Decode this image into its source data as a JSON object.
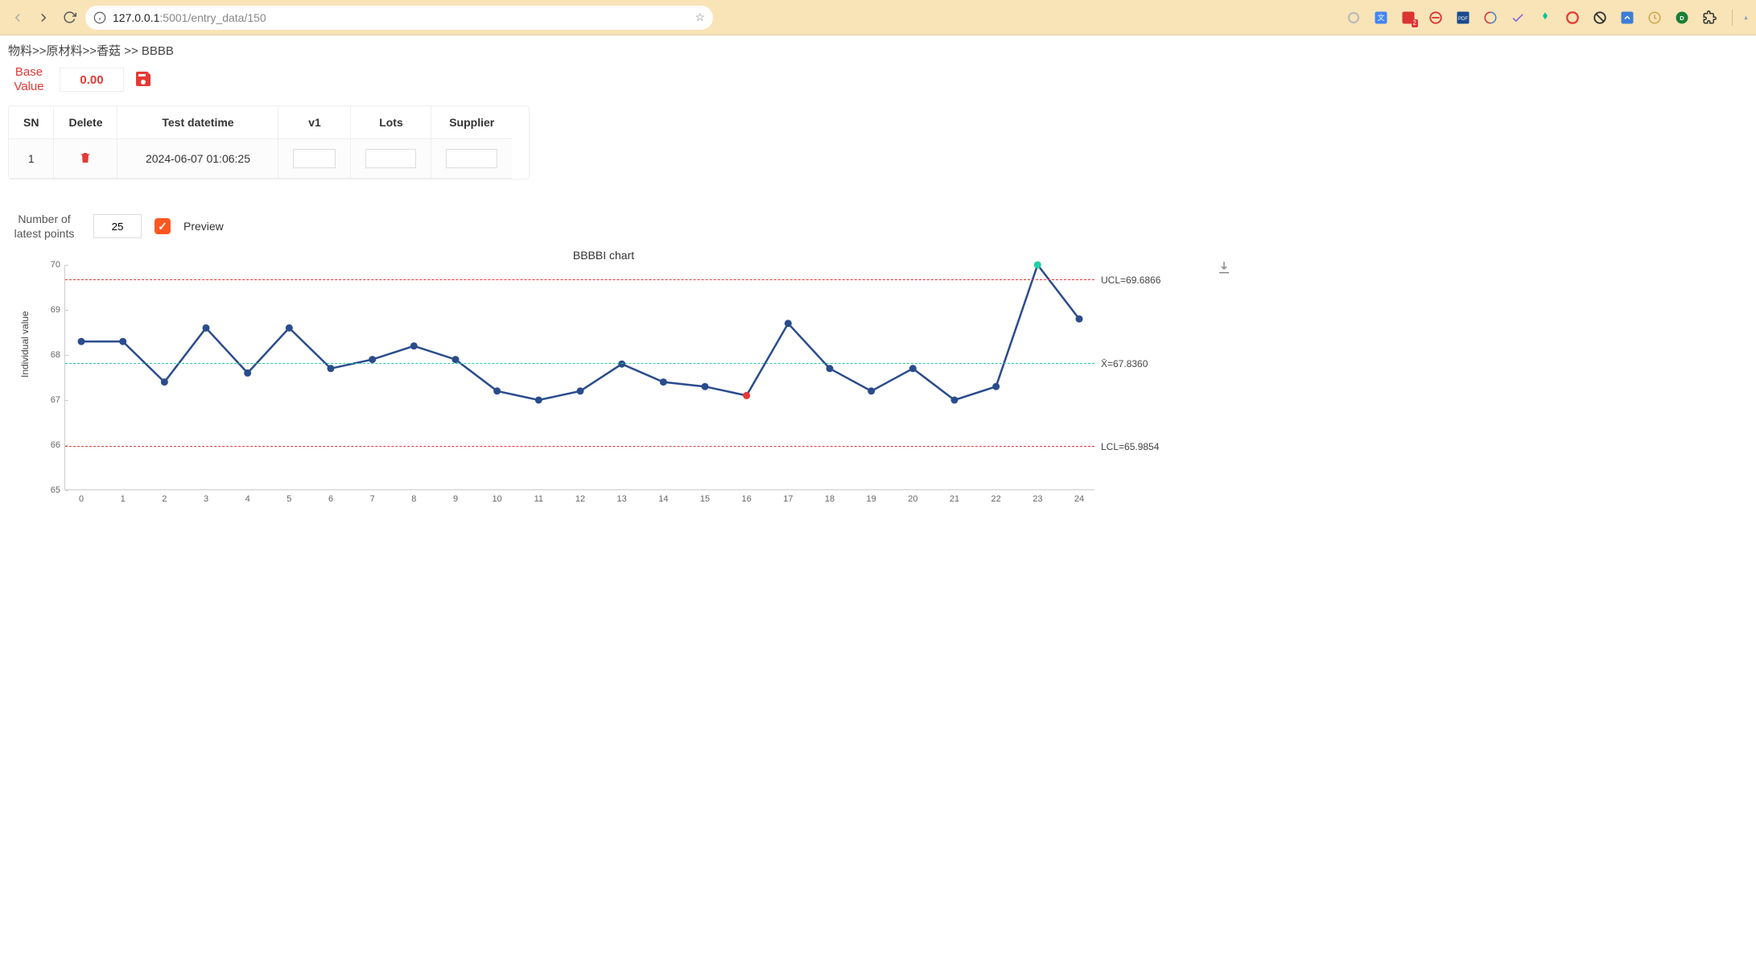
{
  "browser": {
    "url_host": "127.0.0.1",
    "url_port_path": ":5001/entry_data/150"
  },
  "breadcrumb": "物料>>原材料>>香菇 >> BBBB",
  "base": {
    "label_top": "Base",
    "label_bottom": "Value",
    "value": "0.00"
  },
  "table": {
    "headers": {
      "sn": "SN",
      "delete": "Delete",
      "dt": "Test datetime",
      "v1": "v1",
      "lots": "Lots",
      "supplier": "Supplier"
    },
    "rows": [
      {
        "sn": "1",
        "dt": "2024-06-07 01:06:25",
        "v1": "",
        "lots": "",
        "supplier": ""
      }
    ]
  },
  "preview": {
    "label_top": "Number of",
    "label_bottom": "latest points",
    "value": "25",
    "checkbox_checked": true,
    "preview_label": "Preview"
  },
  "chart_data": {
    "type": "line",
    "title": "BBBBI chart",
    "ylabel": "Individual value",
    "xlabel": "",
    "ylim": [
      65,
      70
    ],
    "x": [
      0,
      1,
      2,
      3,
      4,
      5,
      6,
      7,
      8,
      9,
      10,
      11,
      12,
      13,
      14,
      15,
      16,
      17,
      18,
      19,
      20,
      21,
      22,
      23,
      24
    ],
    "values": [
      68.3,
      68.3,
      67.4,
      68.6,
      67.6,
      68.6,
      67.7,
      67.9,
      68.2,
      67.9,
      67.2,
      67.0,
      67.2,
      67.8,
      67.4,
      67.3,
      67.1,
      68.7,
      67.7,
      67.2,
      67.7,
      67.0,
      67.3,
      70.0,
      68.8
    ],
    "point_colors": {
      "normal": "#2a4c8c",
      "red_idx": 16,
      "green_idx": 23
    },
    "hlines": {
      "ucl": {
        "value": 69.6866,
        "label": "UCL=69.6866",
        "color": "red"
      },
      "mean": {
        "value": 67.836,
        "label": "X̄=67.8360",
        "color": "green"
      },
      "lcl": {
        "value": 65.9854,
        "label": "LCL=65.9854",
        "color": "red"
      }
    },
    "y_ticks": [
      65,
      66,
      67,
      68,
      69,
      70
    ]
  }
}
